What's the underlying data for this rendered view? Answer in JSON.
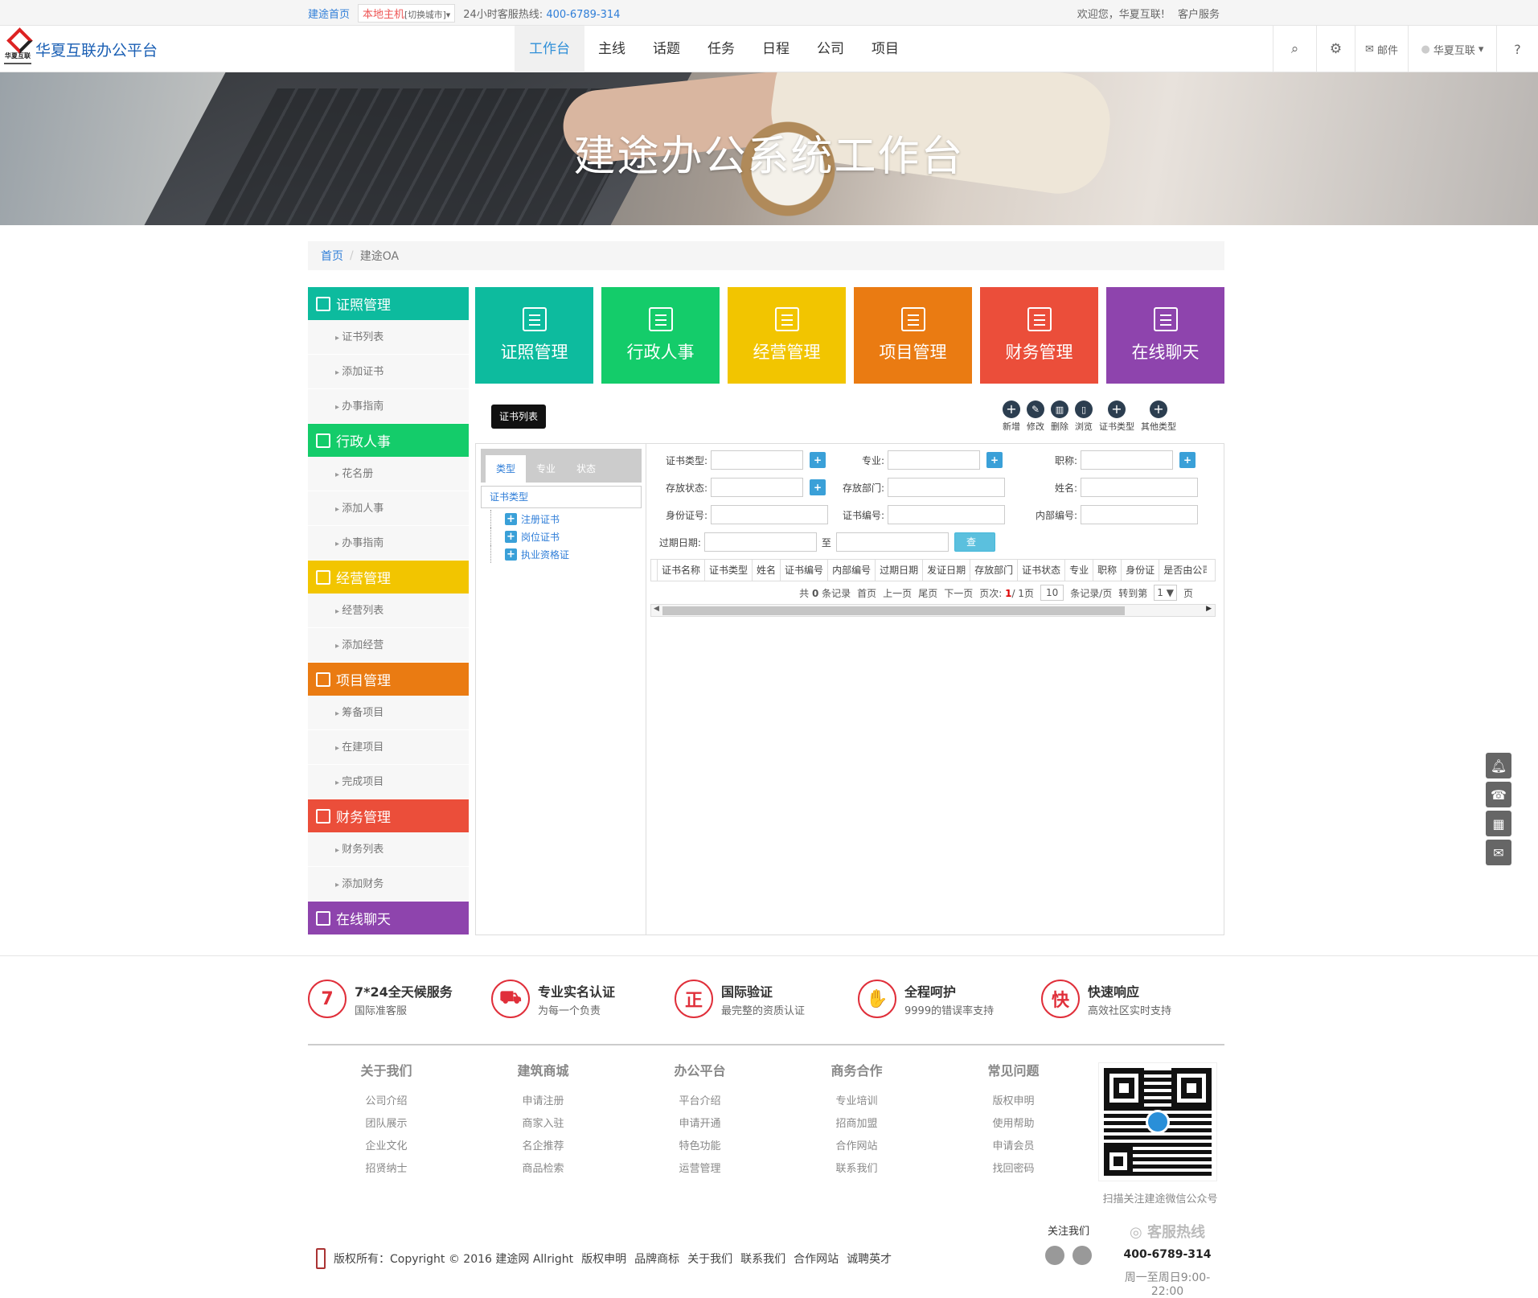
{
  "topbar": {
    "home": "建途首页",
    "host": "本地主机",
    "switch_city": "[切换城市]",
    "hotline_label": "24小时客服热线:",
    "hotline_number": "400-6789-314",
    "welcome": "欢迎您，华夏互联!",
    "service": "客户服务"
  },
  "header": {
    "logo_text": "华夏互联",
    "brand": "华夏互联办公平台",
    "menu": [
      "工作台",
      "主线",
      "话题",
      "任务",
      "日程",
      "公司",
      "项目"
    ],
    "mail": "邮件",
    "user": "华夏互联"
  },
  "banner": {
    "title": "建途办公系统工作台"
  },
  "breadcrumb": {
    "home": "首页",
    "current": "建途OA"
  },
  "sidebar": [
    {
      "title": "证照管理",
      "color": "#0dbb9e",
      "items": [
        "证书列表",
        "添加证书",
        "办事指南"
      ]
    },
    {
      "title": "行政人事",
      "color": "#14cc6a",
      "items": [
        "花名册",
        "添加人事",
        "办事指南"
      ]
    },
    {
      "title": "经营管理",
      "color": "#f2c500",
      "items": [
        "经营列表",
        "添加经营"
      ]
    },
    {
      "title": "项目管理",
      "color": "#ea7b12",
      "items": [
        "筹备项目",
        "在建项目",
        "完成项目"
      ]
    },
    {
      "title": "财务管理",
      "color": "#eb4e3a",
      "items": [
        "财务列表",
        "添加财务"
      ]
    },
    {
      "title": "在线聊天",
      "color": "#8e44ad",
      "items": []
    }
  ],
  "tiles": [
    {
      "label": "证照管理",
      "color": "#0dbb9e"
    },
    {
      "label": "行政人事",
      "color": "#14cc6a"
    },
    {
      "label": "经营管理",
      "color": "#f2c500"
    },
    {
      "label": "项目管理",
      "color": "#ea7b12"
    },
    {
      "label": "财务管理",
      "color": "#eb4e3a"
    },
    {
      "label": "在线聊天",
      "color": "#8e44ad"
    }
  ],
  "toolbar": {
    "chip": "证书列表",
    "actions": [
      "新增",
      "修改",
      "删除",
      "浏览",
      "证书类型",
      "其他类型"
    ]
  },
  "left_panel": {
    "tabs": [
      "类型",
      "专业",
      "状态"
    ],
    "tree_header": "证书类型",
    "nodes": [
      "注册证书",
      "岗位证书",
      "执业资格证"
    ]
  },
  "form": {
    "cert_type": "证书类型:",
    "major": "专业:",
    "title_label": "职称:",
    "storage_status": "存放状态:",
    "storage_dept": "存放部门:",
    "name": "姓名:",
    "id_no": "身份证号:",
    "cert_no": "证书编号:",
    "internal_no": "内部编号:",
    "expiry": "过期日期:",
    "to": "至",
    "query": "查询"
  },
  "grid": {
    "columns": [
      "证书名称",
      "证书类型",
      "姓名",
      "证书编号",
      "内部编号",
      "过期日期",
      "发证日期",
      "存放部门",
      "证书状态",
      "专业",
      "职称",
      "身份证",
      "是否由公司"
    ],
    "pager": {
      "total_prefix": "共",
      "total": "0",
      "total_suffix": "条记录",
      "first": "首页",
      "prev": "上一页",
      "last": "尾页",
      "next": "下一页",
      "page_label": "页次:",
      "page_current": "1",
      "page_total": "/ 1页",
      "per_page": "10",
      "per_page_suffix": "条记录/页",
      "goto": "转到第",
      "goto_val": "1 ▼",
      "goto_suffix": "页"
    }
  },
  "features": [
    {
      "icon": "7",
      "title": "7*24全天候服务",
      "desc": "国际准客服"
    },
    {
      "icon": "⛟",
      "title": "专业实名认证",
      "desc": "为每一个负责"
    },
    {
      "icon": "正",
      "title": "国际验证",
      "desc": "最完整的资质认证"
    },
    {
      "icon": "✋",
      "title": "全程呵护",
      "desc": "9999的错误率支持"
    },
    {
      "icon": "快",
      "title": "快速响应",
      "desc": "高效社区实时支持"
    }
  ],
  "footer_cols": [
    {
      "title": "关于我们",
      "items": [
        "公司介绍",
        "团队展示",
        "企业文化",
        "招贤纳士"
      ]
    },
    {
      "title": "建筑商城",
      "items": [
        "申请注册",
        "商家入驻",
        "名企推荐",
        "商品检索"
      ]
    },
    {
      "title": "办公平台",
      "items": [
        "平台介绍",
        "申请开通",
        "特色功能",
        "运营管理"
      ]
    },
    {
      "title": "商务合作",
      "items": [
        "专业培训",
        "招商加盟",
        "合作网站",
        "联系我们"
      ]
    },
    {
      "title": "常见问题",
      "items": [
        "版权申明",
        "使用帮助",
        "申请会员",
        "找回密码"
      ]
    }
  ],
  "qr_caption": "扫描关注建途微信公众号",
  "copyright": {
    "text": "版权所有：Copyright © 2016 建途网 Allright",
    "links": [
      "版权申明",
      "品牌商标",
      "关于我们",
      "联系我们",
      "合作网站",
      "诚聘英才"
    ]
  },
  "follow": "关注我们",
  "hotline": {
    "title": "客服热线",
    "number": "400-6789-314",
    "hours": "周一至周日9:00-22:00"
  }
}
